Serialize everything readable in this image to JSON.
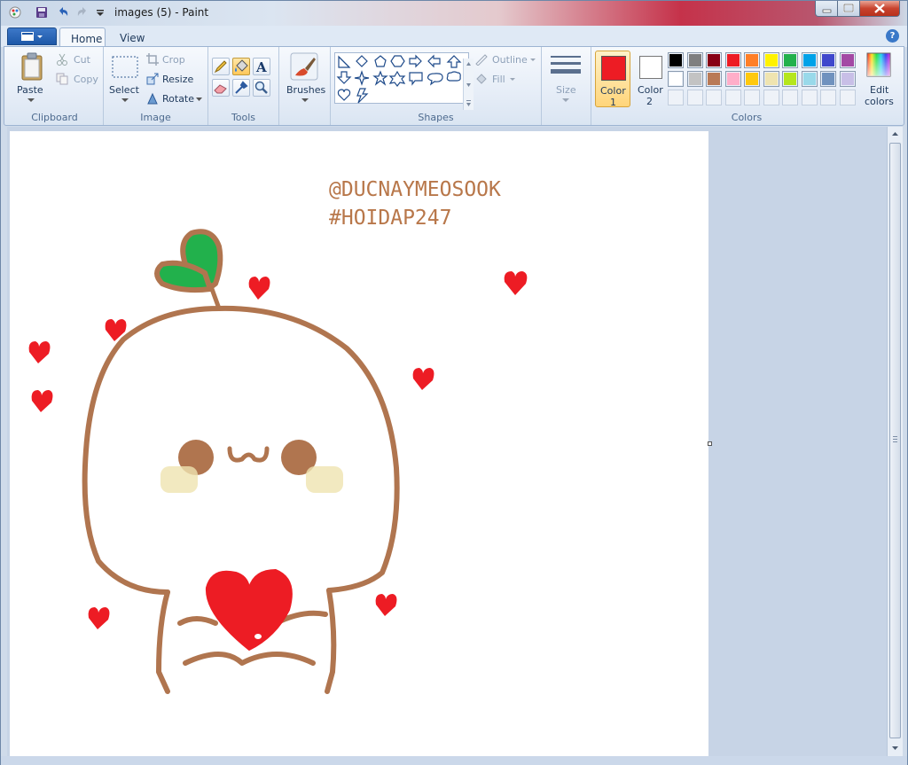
{
  "window": {
    "title": "images (5) - Paint"
  },
  "tabs": [
    {
      "label": "Home"
    },
    {
      "label": "View"
    }
  ],
  "clipboard": {
    "paste": "Paste",
    "cut": "Cut",
    "copy": "Copy",
    "group": "Clipboard"
  },
  "image": {
    "select": "Select",
    "crop": "Crop",
    "resize": "Resize",
    "rotate": "Rotate",
    "group": "Image"
  },
  "tools": {
    "group": "Tools"
  },
  "brushes": {
    "label": "Brushes"
  },
  "shapes": {
    "outline": "Outline",
    "fill": "Fill",
    "group": "Shapes"
  },
  "size": {
    "label": "Size"
  },
  "colors": {
    "color1_label": "Color",
    "color1_num": "1",
    "color2_label": "Color",
    "color2_num": "2",
    "edit_label1": "Edit",
    "edit_label2": "colors",
    "group": "Colors",
    "color1_value": "#ed1c24",
    "color2_value": "#ffffff",
    "palette_row1": [
      "#000000",
      "#7f7f7f",
      "#880015",
      "#ed1c24",
      "#ff7f27",
      "#fff200",
      "#22b14c",
      "#00a2e8",
      "#3f48cc",
      "#a349a4"
    ],
    "palette_row2": [
      "#ffffff",
      "#c3c3c3",
      "#b97a57",
      "#ffaec9",
      "#ffc90e",
      "#efe4b0",
      "#b5e61d",
      "#99d9ea",
      "#7092be",
      "#c8bfe7"
    ]
  },
  "canvas": {
    "watermark_line1": "@DUCNAYMEOSOOK",
    "watermark_line2": "#HOIDAP247",
    "drawing_colors": {
      "outline": "#b0754f",
      "leaf": "#22b14c",
      "heart": "#ed1c24",
      "cheeks": "#efe4b0"
    }
  }
}
